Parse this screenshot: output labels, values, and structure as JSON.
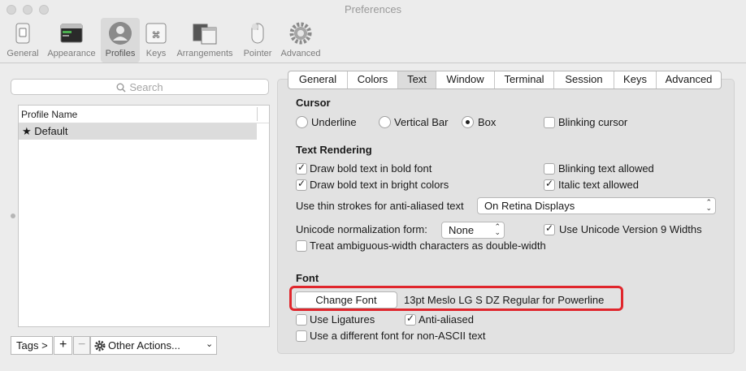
{
  "window": {
    "title": "Preferences"
  },
  "toolbar": {
    "items": [
      {
        "label": "General",
        "icon": "general-switch-icon"
      },
      {
        "label": "Appearance",
        "icon": "appearance-window-icon"
      },
      {
        "label": "Profiles",
        "icon": "profiles-person-icon",
        "selected": true
      },
      {
        "label": "Keys",
        "icon": "keys-command-icon"
      },
      {
        "label": "Arrangements",
        "icon": "arrangements-windows-icon"
      },
      {
        "label": "Pointer",
        "icon": "pointer-mouse-icon"
      },
      {
        "label": "Advanced",
        "icon": "advanced-gear-icon"
      }
    ]
  },
  "search": {
    "placeholder": "Search"
  },
  "profiles": {
    "column_header": "Profile Name",
    "rows": [
      {
        "name": "★ Default",
        "selected": true
      }
    ]
  },
  "bottom_bar": {
    "tags": "Tags >",
    "add": "+",
    "remove": "−",
    "other_actions": "Other Actions..."
  },
  "tabs": [
    {
      "label": "General"
    },
    {
      "label": "Colors"
    },
    {
      "label": "Text",
      "active": true
    },
    {
      "label": "Window"
    },
    {
      "label": "Terminal"
    },
    {
      "label": "Session"
    },
    {
      "label": "Keys"
    },
    {
      "label": "Advanced"
    }
  ],
  "cursor": {
    "heading": "Cursor",
    "options": [
      "Underline",
      "Vertical Bar",
      "Box"
    ],
    "selected": "Box",
    "blinking_label": "Blinking cursor",
    "blinking": false
  },
  "text_rendering": {
    "heading": "Text Rendering",
    "bold_font_label": "Draw bold text in bold font",
    "bold_font": true,
    "bright_colors_label": "Draw bold text in bright colors",
    "bright_colors": true,
    "blinking_text_label": "Blinking text allowed",
    "blinking_text": false,
    "italic_label": "Italic text allowed",
    "italic": true,
    "thin_strokes_label": "Use thin strokes for anti-aliased text",
    "thin_strokes_value": "On Retina Displays",
    "unicode_norm_label": "Unicode normalization form:",
    "unicode_norm_value": "None",
    "unicode9_label": "Use Unicode Version 9 Widths",
    "unicode9": true,
    "ambiguous_label": "Treat ambiguous-width characters as double-width",
    "ambiguous": false
  },
  "font": {
    "heading": "Font",
    "change_button": "Change Font",
    "current_font": "13pt Meslo LG S DZ Regular for Powerline",
    "ligatures_label": "Use Ligatures",
    "ligatures": false,
    "antialiased_label": "Anti-aliased",
    "antialiased": true,
    "non_ascii_label": "Use a different font for non-ASCII text",
    "non_ascii": false
  },
  "colors": {
    "highlight": "#e0262c",
    "window_bg": "#ececec",
    "panel_bg": "#e2e2e2"
  }
}
